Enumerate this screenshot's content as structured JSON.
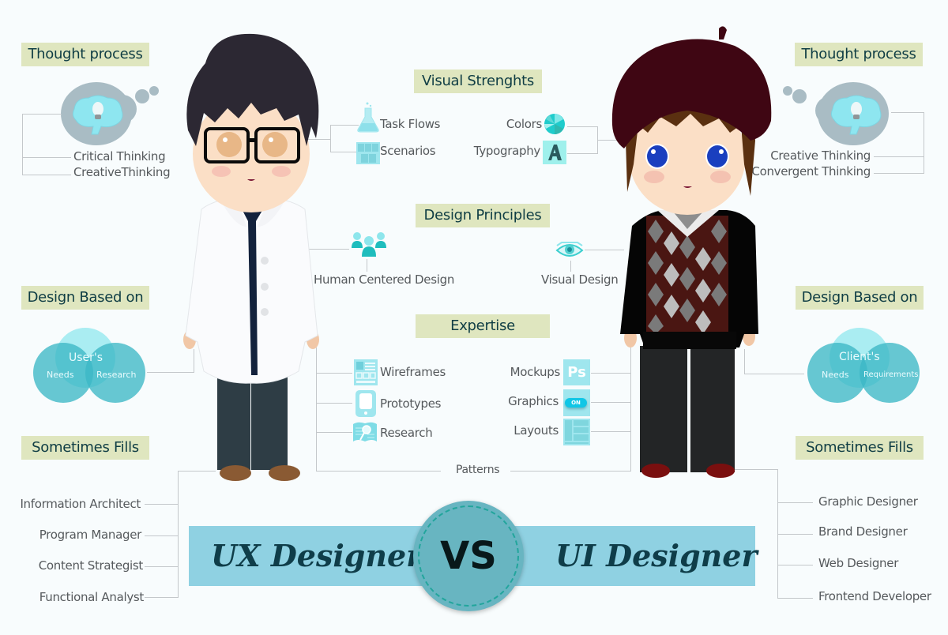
{
  "ux": {
    "title": "UX Designer",
    "thought_process": {
      "heading": "Thought process",
      "items": [
        "Critical Thinking",
        "CreativeThinking"
      ]
    },
    "visual_strengths": [
      {
        "label": "Task Flows",
        "icon": "flask-icon"
      },
      {
        "label": "Scenarios",
        "icon": "grid-icon"
      }
    ],
    "design_principle": {
      "label": "Human Centered Design",
      "icon": "people-icon"
    },
    "design_based_on": {
      "heading": "Design Based on",
      "venn": {
        "top": "User's",
        "left": "Needs",
        "right": "Research"
      }
    },
    "expertise": [
      {
        "label": "Wireframes",
        "icon": "wireframe-icon"
      },
      {
        "label": "Prototypes",
        "icon": "phone-icon"
      },
      {
        "label": "Research",
        "icon": "magnifier-map-icon"
      }
    ],
    "sometimes_fills": {
      "heading": "Sometimes Fills",
      "items": [
        "Information Architect",
        "Program Manager",
        "Content Strategist",
        "Functional Analyst"
      ]
    }
  },
  "ui": {
    "title": "UI Designer",
    "thought_process": {
      "heading": "Thought process",
      "items": [
        "Creative Thinking",
        "Convergent Thinking"
      ]
    },
    "visual_strengths": [
      {
        "label": "Colors",
        "icon": "color-wheel-icon"
      },
      {
        "label": "Typography",
        "icon": "typography-icon"
      }
    ],
    "design_principle": {
      "label": "Visual Design",
      "icon": "eye-icon"
    },
    "design_based_on": {
      "heading": "Design Based on",
      "venn": {
        "top": "Client's",
        "left": "Needs",
        "right": "Requirements"
      }
    },
    "expertise": [
      {
        "label": "Mockups",
        "icon": "photoshop-icon",
        "icon_text": "Ps"
      },
      {
        "label": "Graphics",
        "icon": "toggle-icon",
        "icon_text": "ON"
      },
      {
        "label": "Layouts",
        "icon": "layout-icon"
      }
    ],
    "sometimes_fills": {
      "heading": "Sometimes Fills",
      "items": [
        "Graphic Designer",
        "Brand Designer",
        "Web Designer",
        "Frontend Developer"
      ]
    }
  },
  "center": {
    "visual_strengths_heading": "Visual Strenghts",
    "design_principles_heading": "Design Principles",
    "expertise_heading": "Expertise",
    "shared_label": "Patterns",
    "vs_label": "VS"
  },
  "colors": {
    "label_bg": "#dfe6bf",
    "label_text": "#0f3d44",
    "banner": "#8fd1e2",
    "vs_circle": "#68b5c1",
    "icon_teal": "#9fe6ee",
    "venn": "#4fc1cf",
    "connector": "#c4c8cb"
  }
}
